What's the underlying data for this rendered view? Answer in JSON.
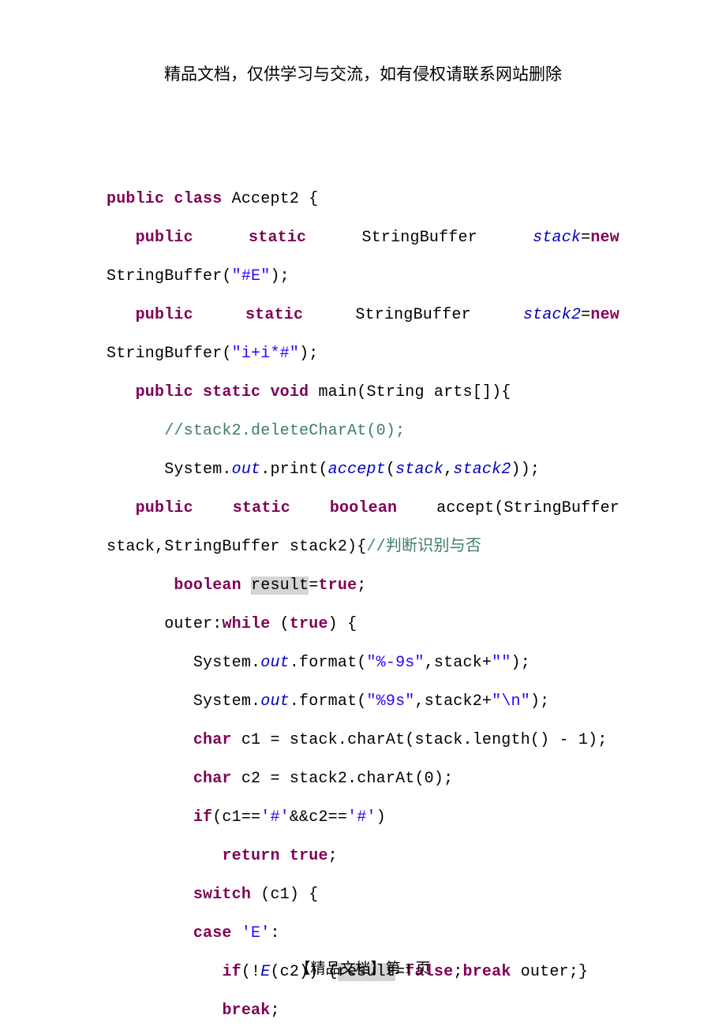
{
  "header": "精品文档，仅供学习与交流，如有侵权请联系网站删除",
  "footer": "【精品文档】第 1 页",
  "code": {
    "l1": {
      "kw1": "public",
      "kw2": "class",
      "name": " Accept2 {"
    },
    "l2": {
      "kw1": "public",
      "kw2": "static",
      "type": "StringBuffer",
      "field": "stack",
      "eq": "=",
      "kw3": "new"
    },
    "l3": {
      "pre": "StringBuffer(",
      "str": "\"#E\"",
      "post": ");"
    },
    "l4": {
      "kw1": "public",
      "kw2": "static",
      "type": "StringBuffer",
      "field": "stack2",
      "eq": "=",
      "kw3": "new"
    },
    "l5": {
      "pre": "StringBuffer(",
      "str": "\"i+i*#\"",
      "post": ");"
    },
    "l6": {
      "indent": "   ",
      "kw1": "public",
      "sp1": " ",
      "kw2": "static",
      "sp2": " ",
      "kw3": "void",
      "rest": " main(String arts[]){"
    },
    "l7": {
      "indent": "      ",
      "cm": "//stack2.deleteCharAt(0);"
    },
    "l8": {
      "indent": "      ",
      "pre": "System.",
      "out": "out",
      "mid": ".print(",
      "fn": "accept",
      "open": "(",
      "a1": "stack",
      "comma": ",",
      "a2": "stack2",
      "close": "));"
    },
    "l9": {
      "kw1": "public",
      "kw2": "static",
      "kw3": "boolean",
      "rest": "accept(StringBuffer"
    },
    "l10": {
      "pre": "stack,StringBuffer stack2){",
      "cm": "//判断识别与否"
    },
    "l11": {
      "indent": "       ",
      "kw": "boolean",
      "sp": " ",
      "var": "result",
      "eq": "=",
      "val": "true",
      "semi": ";"
    },
    "l12": {
      "indent": "      ",
      "lbl": "outer:",
      "kw1": "while",
      "sp": " (",
      "kw2": "true",
      "rest": ") {"
    },
    "l13": {
      "indent": "         ",
      "pre": "System.",
      "out": "out",
      "mid": ".format(",
      "str": "\"%-9s\"",
      "post": ",stack+",
      "str2": "\"\"",
      "end": ");"
    },
    "l14": {
      "indent": "         ",
      "pre": "System.",
      "out": "out",
      "mid": ".format(",
      "str": "\"%9s\"",
      "post": ",stack2+",
      "str2": "\"\\n\"",
      "end": ");"
    },
    "l15": {
      "indent": "         ",
      "kw": "char",
      "rest": " c1 = stack.charAt(stack.length() - 1);"
    },
    "l16": {
      "indent": "         ",
      "kw": "char",
      "rest": " c2 = stack2.charAt(0);"
    },
    "l17": {
      "indent": "         ",
      "kw": "if",
      "pre": "(c1==",
      "s1": "'#'",
      "mid": "&&c2==",
      "s2": "'#'",
      "post": ")"
    },
    "l18": {
      "indent": "            ",
      "kw": "return",
      "sp": " ",
      "val": "true",
      "semi": ";"
    },
    "l19": {
      "indent": "         ",
      "kw": "switch",
      "rest": " (c1) {"
    },
    "l20": {
      "indent": "         ",
      "kw": "case",
      "sp": " ",
      "str": "'E'",
      "colon": ":"
    },
    "l21": {
      "indent": "            ",
      "kw1": "if",
      "pre": "(!",
      "fn": "E",
      "mid": "(c2)) {",
      "var": "result",
      "eq": "=",
      "val": "false",
      "semi": ";",
      "kw2": "break",
      "rest": " outer;}"
    },
    "l22": {
      "indent": "            ",
      "kw": "break",
      "semi": ";"
    }
  }
}
